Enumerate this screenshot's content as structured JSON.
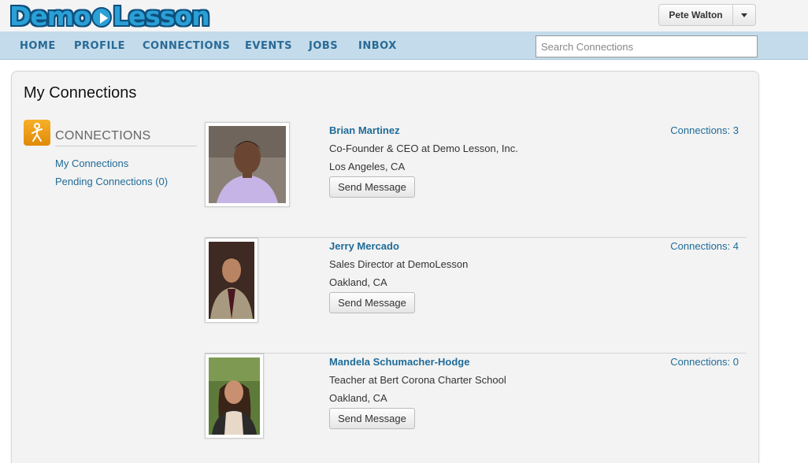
{
  "header": {
    "logo_text_a": "Demo",
    "logo_text_b": "Lesson",
    "user_name": "Pete Walton"
  },
  "nav": {
    "items": [
      "HOME",
      "PROFILE",
      "CONNECTIONS",
      "EVENTS",
      "JOBS",
      "INBOX"
    ],
    "search_placeholder": "Search Connections"
  },
  "page": {
    "title": "My Connections"
  },
  "sidebar": {
    "heading": "CONNECTIONS",
    "links": [
      "My Connections",
      "Pending Connections (0)"
    ]
  },
  "connections": [
    {
      "name": "Brian Martinez",
      "title": "Co-Founder & CEO at Demo Lesson, Inc.",
      "location": "Los Angeles, CA",
      "count_label": "Connections: 3",
      "button": "Send Message"
    },
    {
      "name": "Jerry Mercado",
      "title": "Sales Director at DemoLesson",
      "location": "Oakland, CA",
      "count_label": "Connections: 4",
      "button": "Send Message"
    },
    {
      "name": "Mandela Schumacher-Hodge",
      "title": "Teacher at Bert Corona Charter School",
      "location": "Oakland, CA",
      "count_label": "Connections: 0",
      "button": "Send Message"
    }
  ],
  "colors": {
    "nav_bg": "#c3dbea",
    "link": "#1f6b98",
    "logo": "#2aa0d6"
  }
}
